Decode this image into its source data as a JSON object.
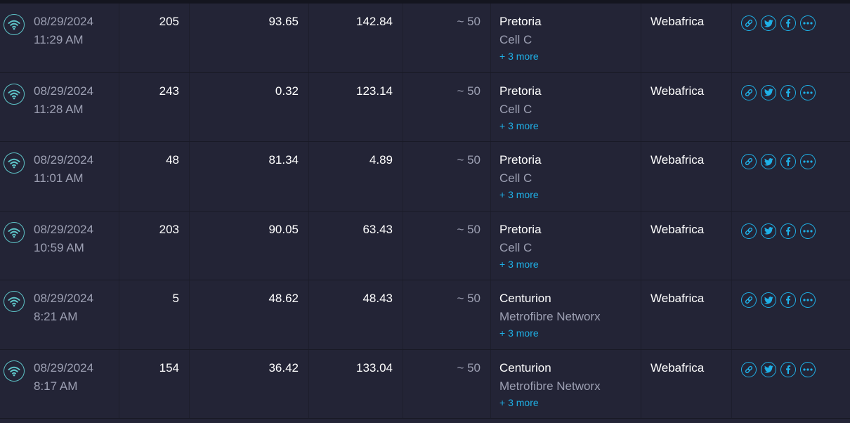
{
  "colors": {
    "background": "#1b1c28",
    "row": "#232436",
    "muted_text": "#9da0b3",
    "accent_blue": "#1fb0e6",
    "wifi_teal": "#5ec4c8"
  },
  "icons": {
    "connection": "wifi-icon",
    "share": [
      "link-icon",
      "twitter-icon",
      "facebook-icon",
      "more-icon"
    ]
  },
  "results": [
    {
      "date": "08/29/2024",
      "time": "11:29 AM",
      "ping": "205",
      "download": "93.65",
      "upload": "142.84",
      "distance": "~ 50",
      "city": "Pretoria",
      "sponsor": "Cell C",
      "more": "+ 3 more",
      "isp": "Webafrica"
    },
    {
      "date": "08/29/2024",
      "time": "11:28 AM",
      "ping": "243",
      "download": "0.32",
      "upload": "123.14",
      "distance": "~ 50",
      "city": "Pretoria",
      "sponsor": "Cell C",
      "more": "+ 3 more",
      "isp": "Webafrica"
    },
    {
      "date": "08/29/2024",
      "time": "11:01 AM",
      "ping": "48",
      "download": "81.34",
      "upload": "4.89",
      "distance": "~ 50",
      "city": "Pretoria",
      "sponsor": "Cell C",
      "more": "+ 3 more",
      "isp": "Webafrica"
    },
    {
      "date": "08/29/2024",
      "time": "10:59 AM",
      "ping": "203",
      "download": "90.05",
      "upload": "63.43",
      "distance": "~ 50",
      "city": "Pretoria",
      "sponsor": "Cell C",
      "more": "+ 3 more",
      "isp": "Webafrica"
    },
    {
      "date": "08/29/2024",
      "time": "8:21 AM",
      "ping": "5",
      "download": "48.62",
      "upload": "48.43",
      "distance": "~ 50",
      "city": "Centurion",
      "sponsor": "Metrofibre Networx",
      "more": "+ 3 more",
      "isp": "Webafrica"
    },
    {
      "date": "08/29/2024",
      "time": "8:17 AM",
      "ping": "154",
      "download": "36.42",
      "upload": "133.04",
      "distance": "~ 50",
      "city": "Centurion",
      "sponsor": "Metrofibre Networx",
      "more": "+ 3 more",
      "isp": "Webafrica"
    }
  ]
}
